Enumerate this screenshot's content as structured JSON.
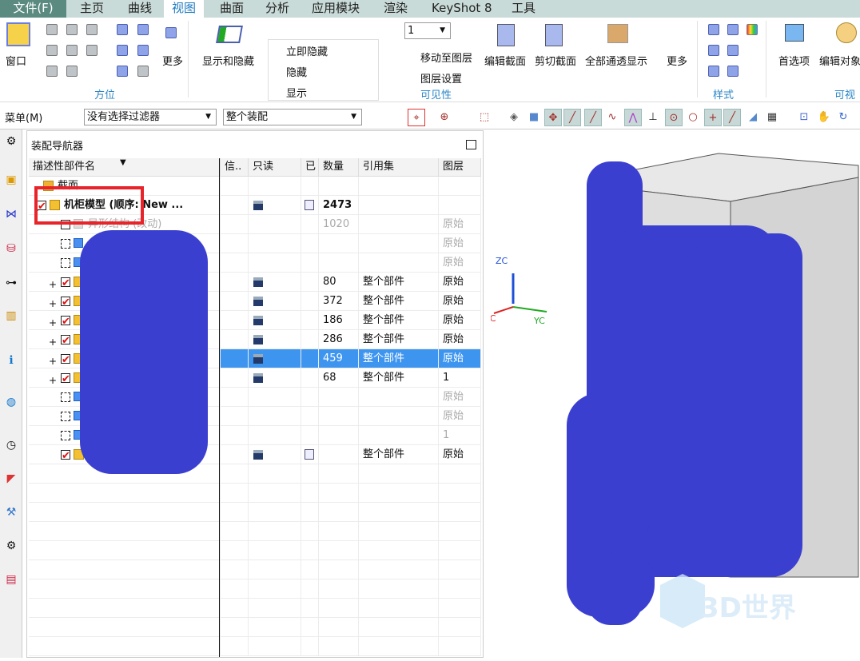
{
  "tabs": [
    {
      "label": "文件(F)"
    },
    {
      "label": "主页"
    },
    {
      "label": "曲线"
    },
    {
      "label": "视图"
    },
    {
      "label": "曲面"
    },
    {
      "label": "分析"
    },
    {
      "label": "应用模块"
    },
    {
      "label": "渲染"
    },
    {
      "label": "KeyShot 8"
    },
    {
      "label": "工具"
    }
  ],
  "ribbon": {
    "window": "窗口",
    "more1": "更多",
    "orientation_group": "方位",
    "show_hide": "显示和隐藏",
    "hide_now": "立即隐藏",
    "hide": "隐藏",
    "show": "显示",
    "layer_value": "1",
    "move_to_layer": "移动至图层",
    "layer_settings": "图层设置",
    "visibility_group": "可见性",
    "edit_section": "编辑截面",
    "clip_section": "剪切截面",
    "all_transparent": "全部通透显示",
    "more2": "更多",
    "style_group": "样式",
    "preferences": "首选项",
    "edit_object": "编辑对象",
    "visual_group": "可视"
  },
  "toolbar": {
    "menu": "菜单(M)",
    "filter": "没有选择过滤器",
    "scope": "整个装配"
  },
  "navigator": {
    "title": "装配导航器",
    "columns": [
      "描述性部件名",
      "信..",
      "只读",
      "已",
      "数量",
      "引用集",
      "图层"
    ],
    "rows": [
      {
        "name": "截面",
        "kind": "folder"
      },
      {
        "name": "机柜模型 (顺序: New ...",
        "kind": "asm",
        "checked": true,
        "expand": true,
        "readonly": true,
        "edited": true,
        "qty": "2473",
        "bold": true
      },
      {
        "name": "异形结构 (改动)",
        "kind": "ghost",
        "qty": "1020",
        "layer": "原始",
        "gray": true
      },
      {
        "name": "",
        "kind": "part",
        "layer": "原始",
        "gray": true
      },
      {
        "name": "",
        "kind": "part",
        "layer": "原始",
        "gray": true
      },
      {
        "name": "",
        "kind": "asm",
        "checked": true,
        "expand": true,
        "readonly": true,
        "qty": "80",
        "ref": "整个部件",
        "layer": "原始"
      },
      {
        "name": "",
        "kind": "asm",
        "checked": true,
        "expand": true,
        "readonly": true,
        "qty": "372",
        "ref": "整个部件",
        "layer": "原始"
      },
      {
        "name": "",
        "kind": "asm",
        "checked": true,
        "expand": true,
        "readonly": true,
        "qty": "186",
        "ref": "整个部件",
        "layer": "原始"
      },
      {
        "name": "",
        "kind": "asm",
        "checked": true,
        "expand": true,
        "readonly": true,
        "qty": "286",
        "ref": "整个部件",
        "layer": "原始"
      },
      {
        "name": "",
        "kind": "asm",
        "checked": true,
        "expand": true,
        "readonly": true,
        "qty": "459",
        "ref": "整个部件",
        "layer": "原始",
        "selected": true
      },
      {
        "name": "",
        "kind": "asm",
        "checked": true,
        "expand": true,
        "readonly": true,
        "qty": "68",
        "ref": "整个部件",
        "layer": "1"
      },
      {
        "name": "",
        "kind": "part",
        "layer": "原始",
        "gray": true
      },
      {
        "name": "",
        "kind": "part",
        "layer": "原始",
        "gray": true
      },
      {
        "name": "",
        "kind": "part",
        "layer": "1",
        "gray": true
      },
      {
        "name": "",
        "kind": "part1",
        "checked": true,
        "readonly": true,
        "edited": true,
        "ref": "整个部件",
        "layer": "原始"
      }
    ]
  },
  "viewport": {
    "axis_z": "ZC",
    "axis_y": "YC",
    "axis_x": "XC",
    "watermark": "3D世界"
  },
  "colors": {
    "accent": "#1e7ac0",
    "selection": "#3d95f0",
    "file_tab": "#5a8a80",
    "highlight_box": "#e8232a",
    "redaction": "#3a3fd0"
  }
}
